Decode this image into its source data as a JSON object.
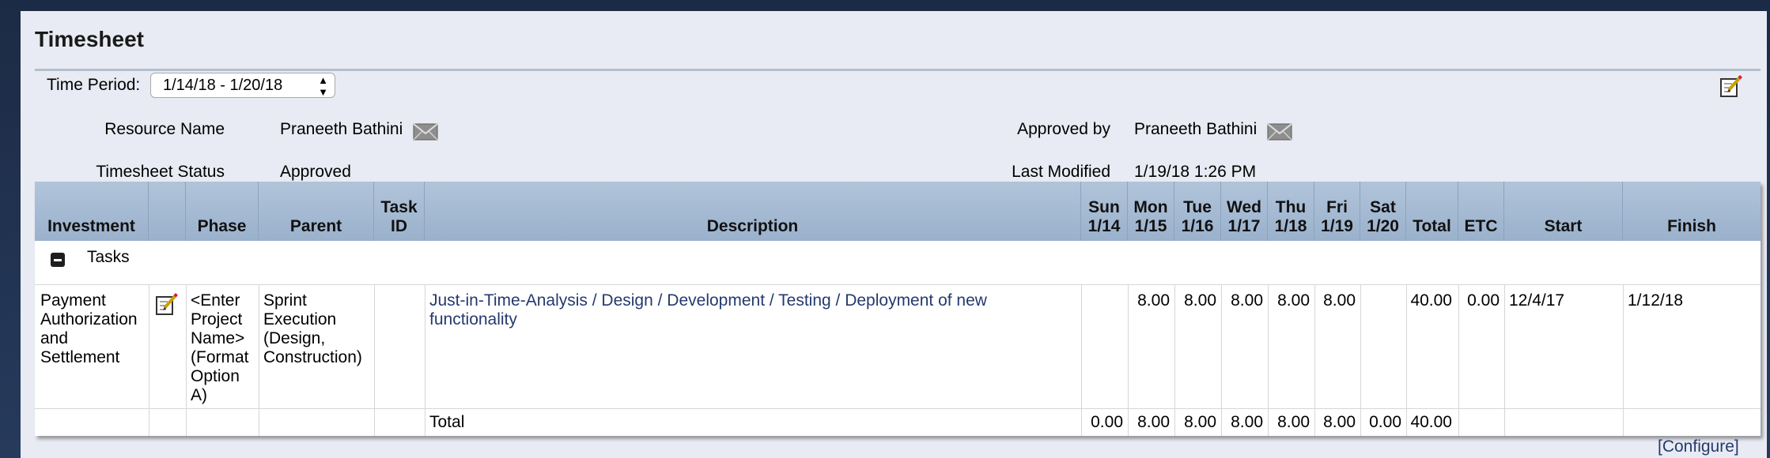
{
  "page": {
    "title": "Timesheet"
  },
  "period": {
    "label": "Time Period:",
    "selected": "1/14/18 - 1/20/18"
  },
  "info": {
    "resource_label": "Resource Name",
    "resource_value": "Praneeth Bathini",
    "status_label": "Timesheet Status",
    "status_value": "Approved",
    "approved_label": "Approved by",
    "approved_value": "Praneeth Bathini",
    "modified_label": "Last Modified",
    "modified_value": "1/19/18 1:26 PM"
  },
  "columns": {
    "investment": "Investment",
    "phase": "Phase",
    "parent": "Parent",
    "task_id": [
      "Task",
      "ID"
    ],
    "description": "Description",
    "sun": [
      "Sun",
      "1/14"
    ],
    "mon": [
      "Mon",
      "1/15"
    ],
    "tue": [
      "Tue",
      "1/16"
    ],
    "wed": [
      "Wed",
      "1/17"
    ],
    "thu": [
      "Thu",
      "1/18"
    ],
    "fri": [
      "Fri",
      "1/19"
    ],
    "sat": [
      "Sat",
      "1/20"
    ],
    "total": "Total",
    "etc": "ETC",
    "start": "Start",
    "finish": "Finish"
  },
  "group": {
    "label": "Tasks"
  },
  "row": {
    "investment": [
      "Payment",
      "Authorization",
      "and",
      "Settlement"
    ],
    "phase": [
      "<Enter",
      "Project",
      "Name>",
      "(Format",
      "Option",
      "A)"
    ],
    "parent": [
      "Sprint",
      "Execution",
      "(Design,",
      "Construction)"
    ],
    "task_id": "",
    "description": [
      "Just-in-Time-Analysis / Design / Development / Testing / Deployment of new",
      "functionality"
    ],
    "sun": "",
    "mon": "8.00",
    "tue": "8.00",
    "wed": "8.00",
    "thu": "8.00",
    "fri": "8.00",
    "sat": "",
    "total": "40.00",
    "etc": "0.00",
    "start": "12/4/17",
    "finish": "1/12/18"
  },
  "totals": {
    "label": "Total",
    "sun": "0.00",
    "mon": "8.00",
    "tue": "8.00",
    "wed": "8.00",
    "thu": "8.00",
    "fri": "8.00",
    "sat": "0.00",
    "total": "40.00"
  },
  "footer": {
    "configure": "[Configure]"
  },
  "icons": {
    "edit": "edit-notepad-icon",
    "mail": "envelope-icon",
    "collapse": "minus-square-icon"
  }
}
